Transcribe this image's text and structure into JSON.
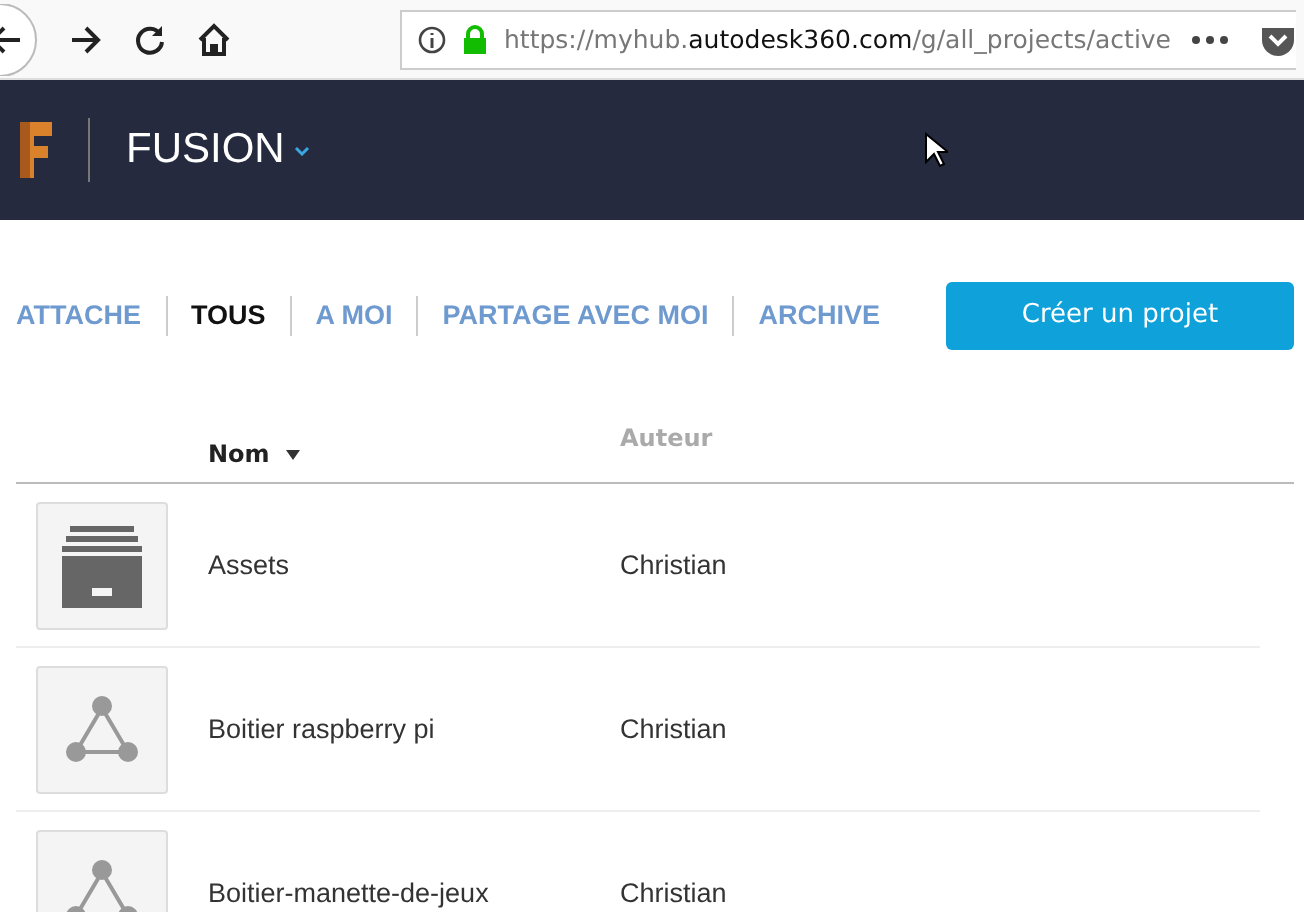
{
  "browser": {
    "url": {
      "prefix": "https://myhub.",
      "domain": "autodesk360.com",
      "path": "/g/all_projects/active"
    }
  },
  "header": {
    "title": "FUSION"
  },
  "tabs": [
    {
      "label": "ATTACHE",
      "selected": false
    },
    {
      "label": "TOUS",
      "selected": true
    },
    {
      "label": "A MOI",
      "selected": false
    },
    {
      "label": "PARTAGE AVEC MOI",
      "selected": false
    },
    {
      "label": "ARCHIVE",
      "selected": false
    }
  ],
  "create_button": "Créer un projet",
  "table": {
    "columns": [
      "Nom",
      "Auteur"
    ],
    "rows": [
      {
        "kind": "archive",
        "name": "Assets",
        "author": "Christian"
      },
      {
        "kind": "design",
        "name": "Boitier raspberry pi",
        "author": "Christian"
      },
      {
        "kind": "design",
        "name": "Boitier-manette-de-jeux",
        "author": "Christian"
      }
    ]
  }
}
